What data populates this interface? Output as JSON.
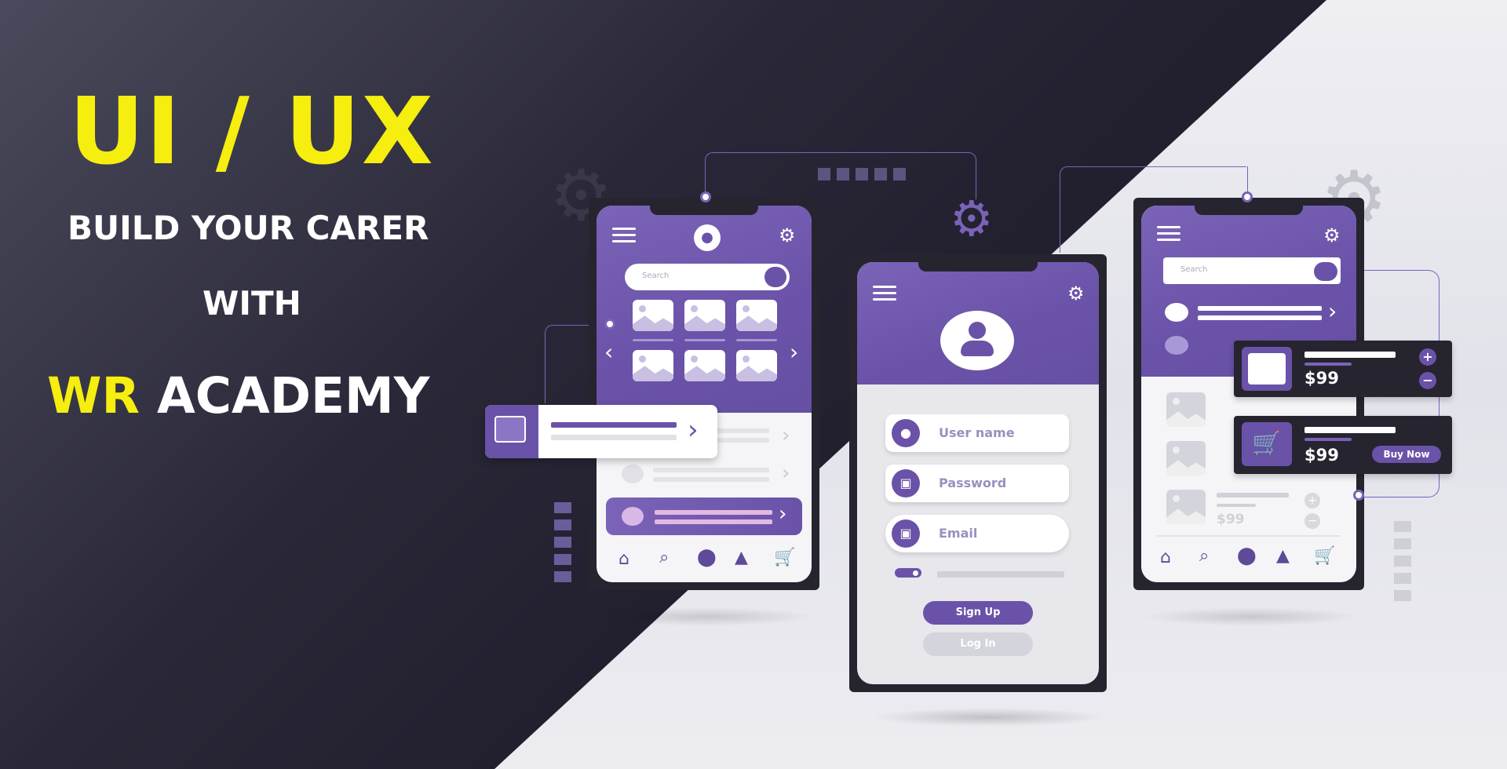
{
  "headline": {
    "uiux": "UI / UX",
    "build": "BUILD YOUR CARER",
    "with": "WITH",
    "academy_wr": "WR",
    "academy_rest": "ACADEMY"
  },
  "colors": {
    "accent": "#6a52a8",
    "highlight": "#f5ee0f",
    "dark": "#1d1b29"
  },
  "phone_left": {
    "search_placeholder": "Search",
    "icons": [
      "menu-icon",
      "user-icon",
      "gear-icon",
      "search-icon",
      "home-icon",
      "location-icon",
      "bell-icon",
      "cart-icon"
    ]
  },
  "phone_center": {
    "fields": [
      {
        "label": "User name",
        "icon": "user-icon"
      },
      {
        "label": "Password",
        "icon": "lock-icon"
      },
      {
        "label": "Email",
        "icon": "lock-icon"
      }
    ],
    "signup_label": "Sign Up",
    "login_label": "Log In"
  },
  "phone_right": {
    "search_placeholder": "Search",
    "price_list": "$99"
  },
  "cards": [
    {
      "price": "$99",
      "type": "image"
    },
    {
      "price": "$99",
      "type": "cart",
      "buy_label": "Buy Now"
    }
  ]
}
